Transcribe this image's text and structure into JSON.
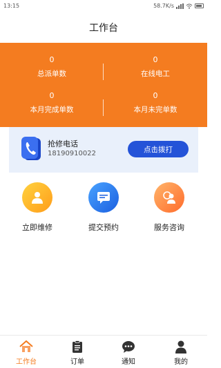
{
  "status_bar": {
    "time": "13:15",
    "network_speed": "58.7K/s"
  },
  "header": {
    "title": "工作台"
  },
  "stats": [
    {
      "value": "0",
      "label": "总派单数"
    },
    {
      "value": "0",
      "label": "在线电工"
    },
    {
      "value": "0",
      "label": "本月完成单数"
    },
    {
      "value": "0",
      "label": "本月未完单数"
    }
  ],
  "hotline": {
    "title": "抢修电话",
    "number": "18190910022",
    "button_label": "点击拨打"
  },
  "actions": [
    {
      "label": "立即维修",
      "icon": "person-icon"
    },
    {
      "label": "提交预约",
      "icon": "message-icon"
    },
    {
      "label": "服务咨询",
      "icon": "service-icon"
    }
  ],
  "tabbar": [
    {
      "label": "工作台",
      "icon": "home-icon",
      "active": true
    },
    {
      "label": "订单",
      "icon": "document-icon",
      "active": false
    },
    {
      "label": "通知",
      "icon": "chat-icon",
      "active": false
    },
    {
      "label": "我的",
      "icon": "user-icon",
      "active": false
    }
  ],
  "colors": {
    "accent": "#f47c20",
    "button": "#2453d8",
    "hotline_bg": "#e9f0fb"
  }
}
